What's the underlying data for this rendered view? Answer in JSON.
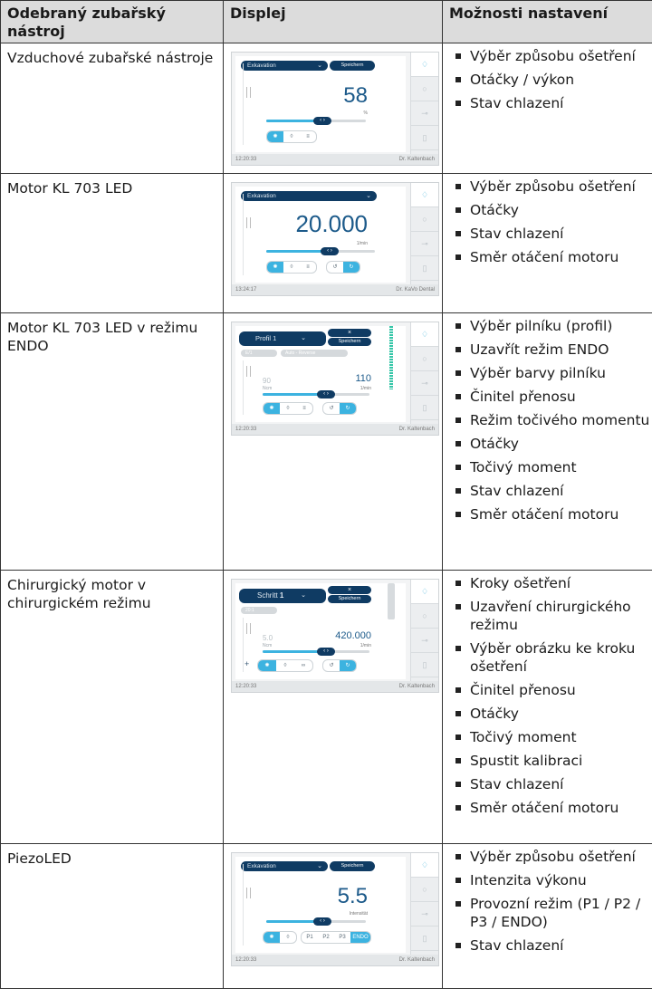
{
  "headers": [
    "Odebraný zubařský nástroj",
    "Displej",
    "Možnosti nastavení"
  ],
  "rows": [
    {
      "tool": "Vzduchové zubařské nástroje",
      "display": {
        "top_select": "Exkavation",
        "save_label": "Speichern",
        "value": "58",
        "unit": "%",
        "time": "12:20:33",
        "user": "Dr. Kaltenbach",
        "bar_fraction": 0.55
      },
      "options": [
        "Výběr způsobu ošetření",
        "Otáčky / výkon",
        "Stav chlazení"
      ]
    },
    {
      "tool": "Motor KL 703 LED",
      "display": {
        "top_select": "Exkavation",
        "value": "20.000",
        "unit": "1/min",
        "time": "13:24:17",
        "user": "Dr. KaVo Dental",
        "bar_fraction": 0.6
      },
      "options": [
        "Výběr způsobu ošetření",
        "Otáčky",
        "Stav chlazení",
        "Směr otáčení motoru"
      ]
    },
    {
      "tool": "Motor KL 703 LED v režimu ENDO",
      "display": {
        "top_select": "Profil 1",
        "save_label": "Speichern",
        "close_label": "×",
        "sub_left": "E/1",
        "sub_right": "Auto - Reverse",
        "left_value": "90",
        "left_unit": "Ncm",
        "value": "110",
        "unit": "1/min",
        "time": "12:20:33",
        "user": "Dr. Kaltenbach",
        "bar_fraction": 0.58
      },
      "options": [
        "Výběr pilníku (profil)",
        "Uzavřít režim ENDO",
        "Výběr barvy pilníku",
        "Činitel přenosu",
        "Režim točivého momentu",
        "Otáčky",
        "Točivý moment",
        "Stav chlazení",
        "Směr otáčení motoru"
      ]
    },
    {
      "tool": "Chirurgický motor v chirurgickém režimu",
      "display": {
        "top_select_prefix": "Schritt",
        "top_select_num": "1",
        "save_label": "Speichern",
        "close_label": "×",
        "sub_left": "20:1",
        "left_value": "5.0",
        "left_unit": "Ncm",
        "value": "420.000",
        "unit": "1/min",
        "time": "12:20:33",
        "user": "Dr. Kaltenbach",
        "bar_fraction": 0.58
      },
      "options": [
        "Kroky ošetření",
        "Uzavření chirurgického režimu",
        "Výběr obrázku ke kroku ošetření",
        "Činitel přenosu",
        "Otáčky",
        "Točivý moment",
        "Spustit kalibraci",
        "Stav chlazení",
        "Směr otáčení motoru"
      ]
    },
    {
      "tool": "PiezoLED",
      "display": {
        "top_select": "Exkavation",
        "save_label": "Speichern",
        "value": "5.5",
        "unit": "Intensität",
        "modes": [
          "P1",
          "P2",
          "P3",
          "ENDO"
        ],
        "time": "12:20:33",
        "user": "Dr. Kaltenbach",
        "bar_fraction": 0.55
      },
      "options": [
        "Výběr způsobu ošetření",
        "Intenzita výkonu",
        "Provozní režim (P1 / P2 / P3 / ENDO)",
        "Stav chlazení"
      ]
    }
  ]
}
